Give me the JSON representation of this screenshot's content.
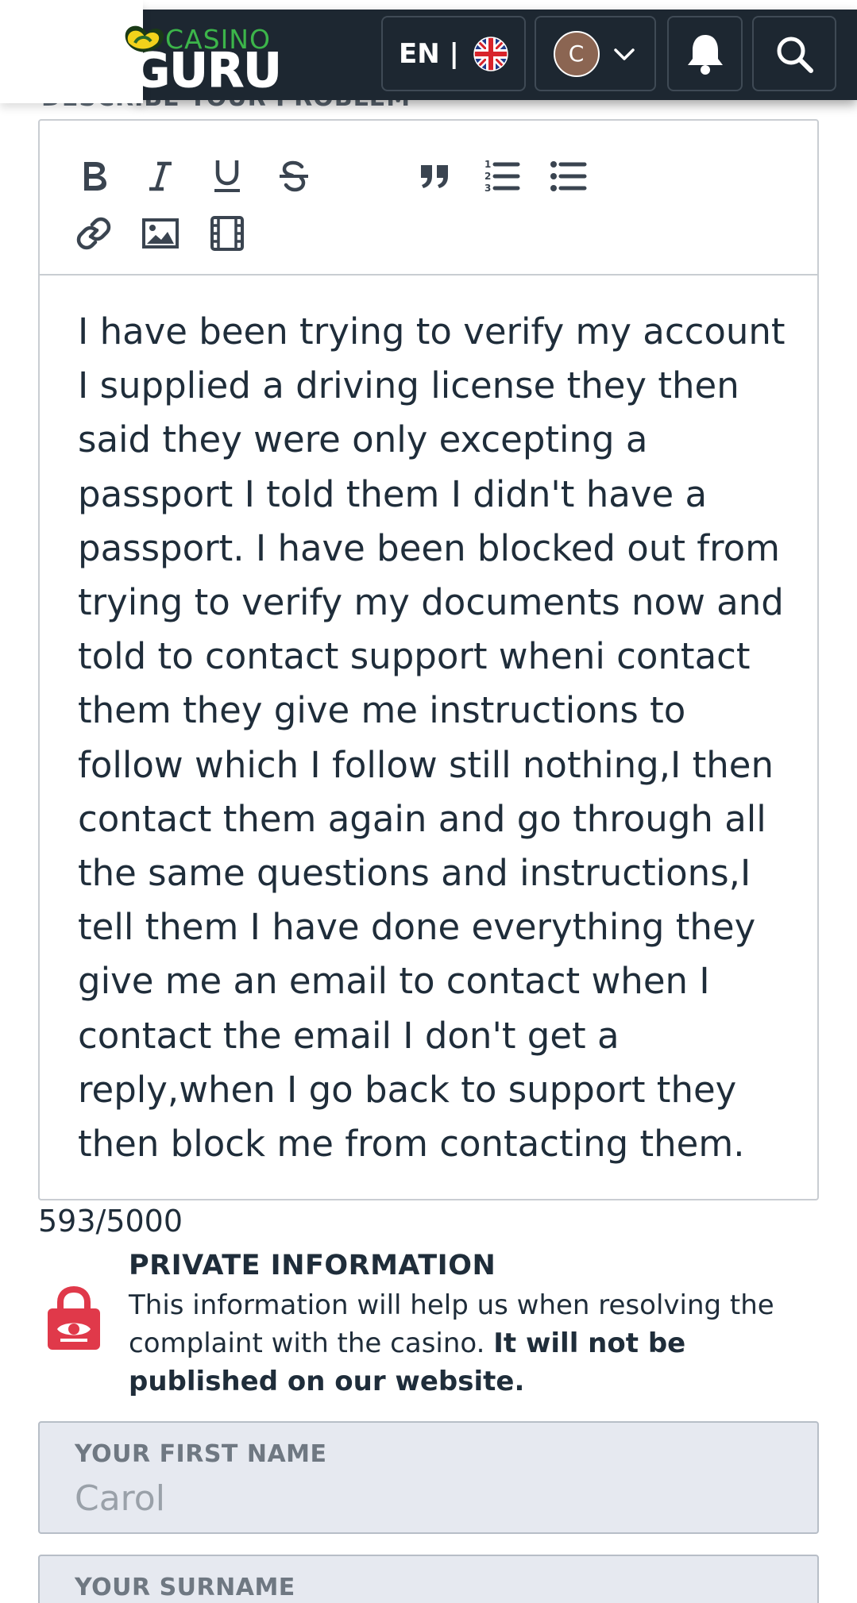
{
  "header": {
    "logo_top": "CASINO",
    "logo_bottom": "GURU",
    "language": "EN |",
    "avatar_initial": "C"
  },
  "form": {
    "section_label": "DESCRIBE YOUR PROBLEM",
    "description": "I have been trying to verify my account\nI supplied a driving license they then\nsaid they were only excepting a\npassport I told them I didn't have a\npassport. I have been blocked out from\ntrying to verify my documents now and\ntold to contact support wheni contact\nthem they give me instructions to\nfollow which I follow still nothing,I then\ncontact them again and go through all\nthe same questions and instructions,I\ntell them I have done everything they\ngive me an email to contact when I\ncontact the email I don't get a\nreply,when I go back to support they\nthen block me from contacting them.",
    "char_count": "593/5000"
  },
  "private_info": {
    "title": "PRIVATE INFORMATION",
    "text": "This information will help us when resolving the complaint with the casino.",
    "text_bold": "It will not be published on our website."
  },
  "fields": {
    "first_name_label": "YOUR FIRST NAME",
    "first_name_value": "Carol",
    "surname_label": "YOUR SURNAME"
  },
  "colors": {
    "header_bg": "#1d2731",
    "brand_green": "#3cb54a",
    "lock_red": "#e0394a",
    "field_bg": "#e6e9f0"
  },
  "icons": [
    "bold-icon",
    "italic-icon",
    "underline-icon",
    "strikethrough-icon",
    "quote-icon",
    "ordered-list-icon",
    "bullet-list-icon",
    "link-icon",
    "image-icon",
    "video-icon",
    "uk-flag-icon",
    "chevron-down-icon",
    "bell-icon",
    "search-icon",
    "lock-icon"
  ]
}
